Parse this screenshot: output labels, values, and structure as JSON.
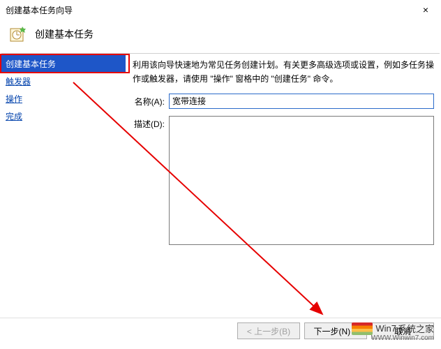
{
  "window": {
    "title": "创建基本任务向导",
    "close": "×"
  },
  "header": {
    "title": "创建基本任务"
  },
  "sidebar": {
    "items": [
      {
        "label": "创建基本任务"
      },
      {
        "label": "触发器"
      },
      {
        "label": "操作"
      },
      {
        "label": "完成"
      }
    ]
  },
  "form": {
    "intro": "利用该向导快速地为常见任务创建计划。有关更多高级选项或设置，例如多任务操作或触发器，请使用 \"操作\" 窗格中的 \"创建任务\" 命令。",
    "name_label": "名称(A):",
    "name_value": "宽带连接",
    "desc_label": "描述(D):",
    "desc_value": ""
  },
  "buttons": {
    "back": "< 上一步(B)",
    "next": "下一步(N) >",
    "cancel": "取消"
  },
  "watermark": {
    "text": "系统之家",
    "sub": "WWW.Winwin7.com",
    "brand_prefix": "Win7"
  }
}
